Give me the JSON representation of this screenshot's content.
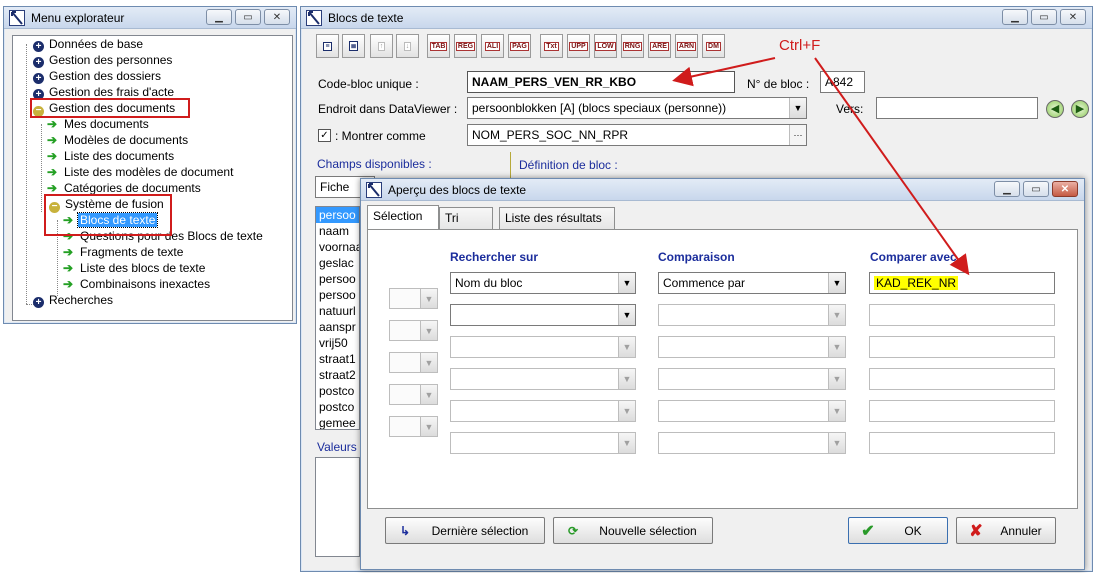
{
  "explorer": {
    "title": "Menu explorateur",
    "items": [
      {
        "label": "Données de base"
      },
      {
        "label": "Gestion des personnes"
      },
      {
        "label": "Gestion des dossiers"
      },
      {
        "label": "Gestion des frais d'acte"
      },
      {
        "label": "Gestion des documents"
      },
      {
        "label": "Mes documents"
      },
      {
        "label": "Modèles de documents"
      },
      {
        "label": "Liste des documents"
      },
      {
        "label": "Liste des modèles de document"
      },
      {
        "label": "Catégories de documents"
      },
      {
        "label": "Système de fusion"
      },
      {
        "label": "Blocs de texte"
      },
      {
        "label": "Questions pour des Blocs de texte"
      },
      {
        "label": "Fragments de texte"
      },
      {
        "label": "Liste des blocs de texte"
      },
      {
        "label": "Combinaisons inexactes"
      },
      {
        "label": "Recherches"
      }
    ]
  },
  "blocs": {
    "title": "Blocs de texte",
    "toolbar_tags": [
      "TAB",
      "REG",
      "ALI",
      "PAG",
      "Txt",
      "UPP",
      "LOW",
      "RNG",
      "ARE",
      "ARN",
      "DM"
    ],
    "code_label": "Code-bloc unique :",
    "code_value": "NAAM_PERS_VEN_RR_KBO",
    "num_label": "N° de bloc :",
    "num_value": "A842",
    "endroit_label": "Endroit dans DataViewer :",
    "endroit_value": "persoonblokken [A] (blocs speciaux (personne))",
    "vers_label": "Vers:",
    "montrer_label": ": Montrer comme",
    "montrer_value": "NOM_PERS_SOC_NN_RPR",
    "montrer_checked": "✓",
    "champs_label": "Champs disponibles :",
    "definition_label": "Définition de bloc :",
    "fiche_value": "Fiche",
    "fields": [
      "persoo",
      "naam",
      "voornaa",
      "geslac",
      "persoo",
      "persoo",
      "natuurl",
      "aanspr",
      "vrij50",
      "straat1",
      "straat2",
      "postco",
      "postco",
      "gemee"
    ],
    "valeurs_label": "Valeurs"
  },
  "annotation": {
    "text": "Ctrl+F",
    "color": "#d01c1c"
  },
  "dialog": {
    "title": "Aperçu des blocs de texte",
    "tabs": [
      "Sélection",
      "Tri",
      "Liste des résultats"
    ],
    "col_rechercher": "Rechercher sur",
    "col_comparaison": "Comparaison",
    "col_comparer": "Comparer avec",
    "row1_rechercher": "Nom du bloc",
    "row1_comparaison": "Commence par",
    "row1_comparer": "KAD_REK_NR",
    "btn_derniere": "Dernière sélection",
    "btn_nouvelle": "Nouvelle sélection",
    "btn_ok": "OK",
    "btn_annuler": "Annuler",
    "highlight_color": "#ffff00"
  }
}
